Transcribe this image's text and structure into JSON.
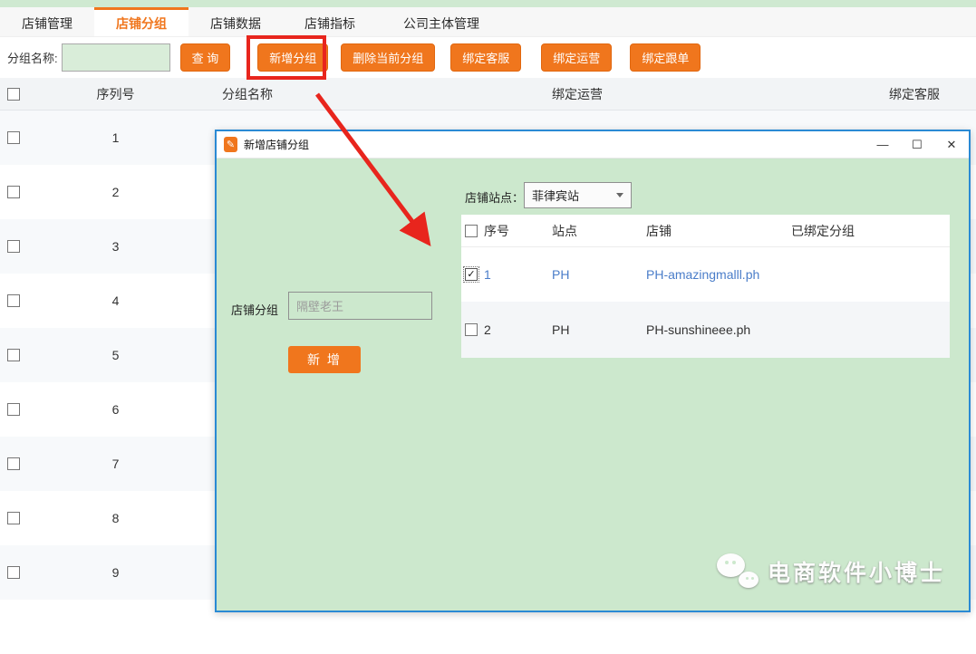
{
  "tabs": [
    {
      "label": "店铺管理",
      "active": false
    },
    {
      "label": "店铺分组",
      "active": true
    },
    {
      "label": "店铺数据",
      "active": false
    },
    {
      "label": "店铺指标",
      "active": false
    },
    {
      "label": "公司主体管理",
      "active": false
    }
  ],
  "toolbar": {
    "group_name_label": "分组名称:",
    "search_value": "",
    "query_button": "查 询",
    "add_group_button": "新增分组",
    "delete_group_button": "删除当前分组",
    "bind_service_button": "绑定客服",
    "bind_operation_button": "绑定运营",
    "bind_follow_button": "绑定跟单"
  },
  "table": {
    "headers": {
      "serial": "序列号",
      "group_name": "分组名称",
      "bind_operation": "绑定运营",
      "bind_service": "绑定客服"
    },
    "rows": [
      "1",
      "2",
      "3",
      "4",
      "5",
      "6",
      "7",
      "8",
      "9"
    ]
  },
  "dialog": {
    "title": "新增店铺分组",
    "controls": {
      "minimize": "—",
      "maximize": "☐",
      "close": "✕"
    },
    "site_label": "店铺站点：",
    "site_value": "菲律宾站",
    "table": {
      "headers": {
        "no": "序号",
        "site": "站点",
        "shop": "店铺",
        "bound_group": "已绑定分组"
      },
      "rows": [
        {
          "no": "1",
          "site": "PH",
          "shop": "PH-amazingmalll.ph",
          "bound_group": "",
          "checked": true
        },
        {
          "no": "2",
          "site": "PH",
          "shop": "PH-sunshineee.ph",
          "bound_group": "",
          "checked": false
        }
      ]
    },
    "group_label": "店铺分组",
    "group_input_value": "隔壁老王",
    "add_button": "新 增"
  },
  "watermark": {
    "text": "电商软件小博士"
  },
  "icons": {
    "dialog_icon": "edit-icon",
    "watermark_icon": "wechat-icon",
    "annotation": "red-arrow-and-box"
  },
  "colors": {
    "accent_orange": "#f0761d",
    "dialog_bg": "#cce8cd",
    "dialog_border": "#2a8ad4",
    "annotation_red": "#e8251d",
    "link_blue": "#4a7dc9",
    "top_strip_green": "#cfe9d1"
  }
}
